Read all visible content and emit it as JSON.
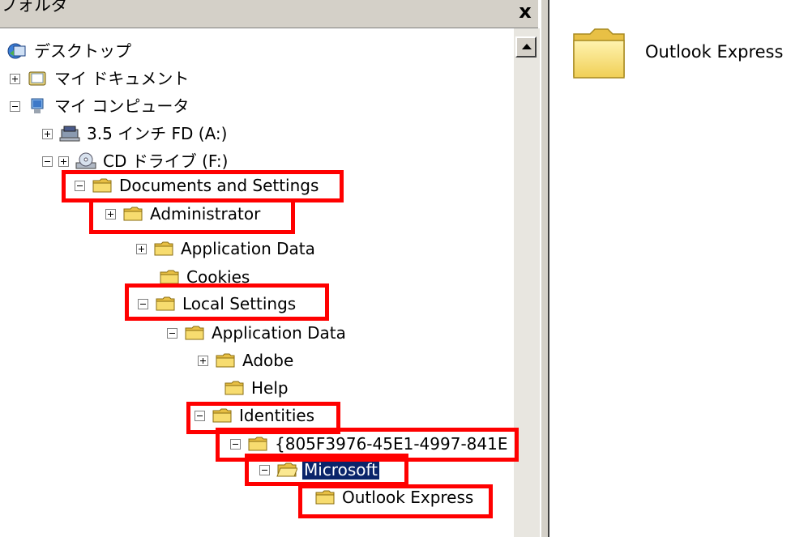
{
  "header": {
    "title": "フォルダ",
    "close_label": "x"
  },
  "tree": [
    {
      "label": "デスクトップ",
      "icon": "desktop-icon",
      "expander": "none",
      "highlighted": false,
      "selected": false
    },
    {
      "label": "マイ ドキュメント",
      "icon": "documents-icon",
      "expander": "plus",
      "highlighted": false,
      "selected": false
    },
    {
      "label": "マイ コンピュータ",
      "icon": "computer-icon",
      "expander": "minus",
      "highlighted": false,
      "selected": false
    },
    {
      "label": "3.5 インチ FD (A:)",
      "icon": "floppy-icon",
      "expander": "plus",
      "highlighted": false,
      "selected": false
    },
    {
      "label": "CD ドライブ (F:)",
      "icon": "cd-drive-icon",
      "expander": "plus",
      "highlighted": false,
      "selected": false
    },
    {
      "label": "Documents and Settings",
      "icon": "folder-icon",
      "expander": "minus",
      "highlighted": true,
      "selected": false
    },
    {
      "label": "Administrator",
      "icon": "folder-icon",
      "expander": "plus",
      "highlighted": true,
      "selected": false
    },
    {
      "label": "Application Data",
      "icon": "folder-icon",
      "expander": "plus",
      "highlighted": false,
      "selected": false
    },
    {
      "label": "Cookies",
      "icon": "folder-icon",
      "expander": "none",
      "highlighted": false,
      "selected": false
    },
    {
      "label": "Local Settings",
      "icon": "folder-icon",
      "expander": "minus",
      "highlighted": true,
      "selected": false
    },
    {
      "label": "Application Data",
      "icon": "folder-icon",
      "expander": "minus",
      "highlighted": false,
      "selected": false
    },
    {
      "label": "Adobe",
      "icon": "folder-icon",
      "expander": "plus",
      "highlighted": false,
      "selected": false
    },
    {
      "label": "Help",
      "icon": "folder-icon",
      "expander": "none",
      "highlighted": false,
      "selected": false
    },
    {
      "label": "Identities",
      "icon": "folder-icon",
      "expander": "minus",
      "highlighted": true,
      "selected": false
    },
    {
      "label": "{805F3976-45E1-4997-841E",
      "icon": "folder-icon",
      "expander": "minus",
      "highlighted": true,
      "selected": false
    },
    {
      "label": "Microsoft",
      "icon": "folder-open-icon",
      "expander": "minus",
      "highlighted": true,
      "selected": true
    },
    {
      "label": "Outlook Express",
      "icon": "folder-icon",
      "expander": "none",
      "highlighted": true,
      "selected": false
    }
  ],
  "right_pane": {
    "items": [
      {
        "label": "Outlook Express",
        "icon": "folder-icon"
      }
    ]
  },
  "colors": {
    "highlight_box": "#ff0000",
    "selection": "#0a246a",
    "folder": "#f2d45c",
    "chrome": "#d4d0c8"
  }
}
